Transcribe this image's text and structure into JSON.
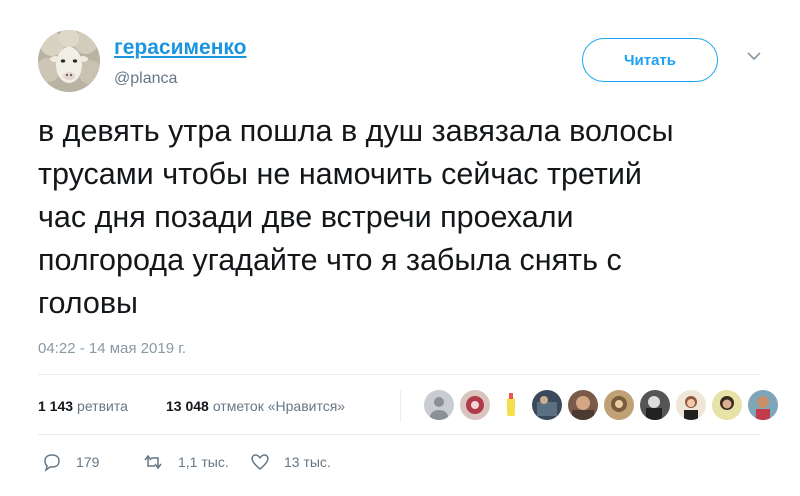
{
  "user": {
    "display_name": "герасименко",
    "handle": "@planca"
  },
  "follow_button": {
    "label": "Читать"
  },
  "tweet": {
    "text": "в девять утра пошла в душ завязала волосы\nтрусами чтобы не намочить сейчас третий\nчас дня позади две встречи проехали\nполгорода угадайте что я забыла снять с\nголовы",
    "timestamp": "04:22 - 14 мая 2019 г."
  },
  "stats": {
    "retweets_count": "1 143",
    "retweets_label": "ретвита",
    "likes_count": "13 048",
    "likes_label": "отметок «Нравится»"
  },
  "actions": {
    "reply_count": "179",
    "retweet_count": "1,1 тыс.",
    "like_count": "13 тыс."
  },
  "colors": {
    "link": "#1b95e0",
    "follow": "#1da1f2",
    "muted": "#657786",
    "text": "#14171a",
    "divider": "#e6ecf0"
  },
  "icons": [
    "chevron-down-icon",
    "reply-icon",
    "retweet-icon",
    "like-icon"
  ]
}
